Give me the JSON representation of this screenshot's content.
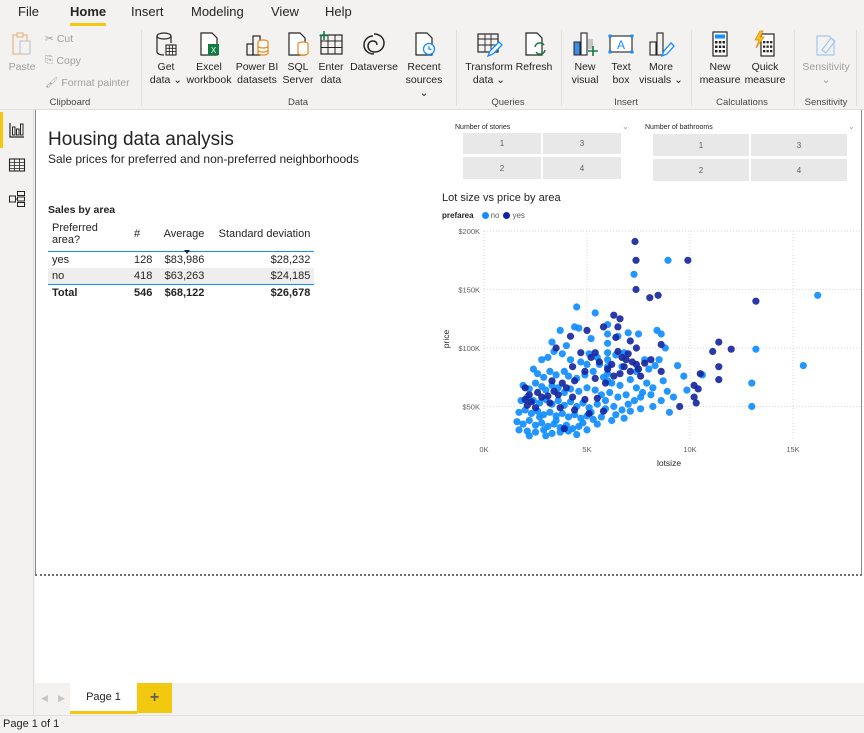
{
  "menu": {
    "items": [
      "File",
      "Home",
      "Insert",
      "Modeling",
      "View",
      "Help"
    ],
    "active": "Home"
  },
  "ribbon": {
    "clipboard": {
      "paste": "Paste",
      "cut": "Cut",
      "copy": "Copy",
      "format_painter": "Format painter",
      "group": "Clipboard"
    },
    "data": {
      "get_data": [
        "Get",
        "data"
      ],
      "excel": [
        "Excel",
        "workbook"
      ],
      "pbi_datasets": [
        "Power BI",
        "datasets"
      ],
      "sql": [
        "SQL",
        "Server"
      ],
      "enter_data": [
        "Enter",
        "data"
      ],
      "dataverse": [
        "Dataverse",
        ""
      ],
      "recent": [
        "Recent",
        "sources"
      ],
      "group": "Data"
    },
    "queries": {
      "transform": [
        "Transform",
        "data"
      ],
      "refresh": [
        "Refresh",
        ""
      ],
      "group": "Queries"
    },
    "insert": {
      "new_visual": [
        "New",
        "visual"
      ],
      "text_box": [
        "Text",
        "box"
      ],
      "more_visuals": [
        "More",
        "visuals"
      ],
      "group": "Insert"
    },
    "calculations": {
      "new_measure": [
        "New",
        "measure"
      ],
      "quick_measure": [
        "Quick",
        "measure"
      ],
      "group": "Calculations"
    },
    "sensitivity": {
      "label": "Sensitivity",
      "group": "Sensitivity"
    }
  },
  "report": {
    "title": "Housing data analysis",
    "subtitle": "Sale prices for preferred and non-preferred neighborhoods",
    "table": {
      "title": "Sales by area",
      "headers": [
        "Preferred area?",
        "#",
        "Average",
        "Standard deviation"
      ],
      "sorted_column": "Average",
      "rows": [
        [
          "yes",
          "128",
          "$83,986",
          "$28,232"
        ],
        [
          "no",
          "418",
          "$63,263",
          "$24,185"
        ]
      ],
      "total": [
        "Total",
        "546",
        "$68,122",
        "$26,678"
      ]
    },
    "slicers": [
      {
        "title": "Number of stories",
        "options": [
          "1",
          "3",
          "2",
          "4"
        ]
      },
      {
        "title": "Number of bathrooms",
        "options": [
          "1",
          "3",
          "2",
          "4"
        ]
      }
    ]
  },
  "chart_data": {
    "type": "scatter",
    "title": "Lot size vs price by area",
    "xlabel": "lotsize",
    "ylabel": "price",
    "legend_title": "prefarea",
    "legend_placement": "top-left",
    "grid": true,
    "xlim": [
      0,
      17000
    ],
    "ylim": [
      22000,
      205000
    ],
    "xticks": [
      {
        "v": 0,
        "label": "0K"
      },
      {
        "v": 5000,
        "label": "5K"
      },
      {
        "v": 10000,
        "label": "10K"
      },
      {
        "v": 15000,
        "label": "15K"
      }
    ],
    "yticks": [
      {
        "v": 50000,
        "label": "$50K"
      },
      {
        "v": 100000,
        "label": "$100K"
      },
      {
        "v": 150000,
        "label": "$150K"
      },
      {
        "v": 200000,
        "label": "$200K"
      }
    ],
    "series": [
      {
        "name": "no",
        "color": "#118dff",
        "points": [
          [
            7280,
            163000
          ],
          [
            8930,
            175000
          ],
          [
            16200,
            145000
          ],
          [
            13200,
            99000
          ],
          [
            15500,
            85000
          ],
          [
            13000,
            70000
          ],
          [
            13000,
            50000
          ],
          [
            10600,
            77000
          ],
          [
            9700,
            76000
          ],
          [
            9850,
            64000
          ],
          [
            9000,
            45000
          ],
          [
            9400,
            85000
          ],
          [
            4500,
            135000
          ],
          [
            5400,
            130000
          ],
          [
            6000,
            120000
          ],
          [
            6000,
            112000
          ],
          [
            6000,
            104000
          ],
          [
            6000,
            96000
          ],
          [
            6000,
            90000
          ],
          [
            6000,
            84000
          ],
          [
            6000,
            78000
          ],
          [
            6000,
            72000
          ],
          [
            3700,
            115000
          ],
          [
            4400,
            118000
          ],
          [
            4600,
            117000
          ],
          [
            5200,
            108000
          ],
          [
            6500,
            110000
          ],
          [
            7000,
            113000
          ],
          [
            7500,
            112000
          ],
          [
            8400,
            115000
          ],
          [
            8600,
            112000
          ],
          [
            8800,
            100000
          ],
          [
            8500,
            90000
          ],
          [
            8300,
            85000
          ],
          [
            2800,
            90000
          ],
          [
            3100,
            92000
          ],
          [
            3400,
            97000
          ],
          [
            3800,
            95000
          ],
          [
            4200,
            90000
          ],
          [
            4700,
            88000
          ],
          [
            5000,
            86000
          ],
          [
            5500,
            92000
          ],
          [
            6400,
            94000
          ],
          [
            6800,
            96000
          ],
          [
            7800,
            90000
          ],
          [
            8000,
            82000
          ],
          [
            2400,
            82000
          ],
          [
            2600,
            78000
          ],
          [
            2900,
            75000
          ],
          [
            3200,
            80000
          ],
          [
            3500,
            77000
          ],
          [
            3900,
            80000
          ],
          [
            4100,
            76000
          ],
          [
            4500,
            74000
          ],
          [
            4900,
            77000
          ],
          [
            5300,
            80000
          ],
          [
            5800,
            75000
          ],
          [
            6200,
            70000
          ],
          [
            6600,
            68000
          ],
          [
            7100,
            73000
          ],
          [
            7400,
            66000
          ],
          [
            7900,
            70000
          ],
          [
            1900,
            68000
          ],
          [
            2200,
            65000
          ],
          [
            2500,
            70000
          ],
          [
            2800,
            67000
          ],
          [
            3000,
            64000
          ],
          [
            3300,
            68000
          ],
          [
            3600,
            66000
          ],
          [
            3900,
            62000
          ],
          [
            4200,
            65000
          ],
          [
            4600,
            63000
          ],
          [
            5000,
            66000
          ],
          [
            5400,
            64000
          ],
          [
            5700,
            60000
          ],
          [
            6100,
            62000
          ],
          [
            6500,
            58000
          ],
          [
            6900,
            60000
          ],
          [
            7300,
            55000
          ],
          [
            7600,
            58000
          ],
          [
            8100,
            60000
          ],
          [
            1800,
            55000
          ],
          [
            2100,
            58000
          ],
          [
            2400,
            55000
          ],
          [
            2700,
            53000
          ],
          [
            3000,
            56000
          ],
          [
            3300,
            52000
          ],
          [
            3600,
            55000
          ],
          [
            3900,
            51000
          ],
          [
            4200,
            54000
          ],
          [
            4500,
            50000
          ],
          [
            4800,
            53000
          ],
          [
            5100,
            49000
          ],
          [
            5500,
            52000
          ],
          [
            5900,
            48000
          ],
          [
            6300,
            50000
          ],
          [
            6700,
            47000
          ],
          [
            7100,
            46000
          ],
          [
            7600,
            48000
          ],
          [
            1700,
            45000
          ],
          [
            2000,
            47000
          ],
          [
            2300,
            44000
          ],
          [
            2600,
            46000
          ],
          [
            2900,
            43000
          ],
          [
            3200,
            45000
          ],
          [
            3500,
            42000
          ],
          [
            3800,
            44000
          ],
          [
            4100,
            41000
          ],
          [
            4400,
            43000
          ],
          [
            4700,
            40000
          ],
          [
            5000,
            42000
          ],
          [
            5300,
            39000
          ],
          [
            5700,
            41000
          ],
          [
            6200,
            38000
          ],
          [
            6800,
            40000
          ],
          [
            1600,
            37000
          ],
          [
            1900,
            35000
          ],
          [
            2200,
            38000
          ],
          [
            2500,
            34000
          ],
          [
            2800,
            36000
          ],
          [
            3100,
            33000
          ],
          [
            3400,
            35000
          ],
          [
            3700,
            32000
          ],
          [
            4000,
            34000
          ],
          [
            4300,
            31000
          ],
          [
            4600,
            33000
          ],
          [
            5000,
            30000
          ],
          [
            5500,
            35000
          ],
          [
            1700,
            30000
          ],
          [
            2100,
            29000
          ],
          [
            2500,
            28000
          ],
          [
            2900,
            30000
          ],
          [
            3300,
            27000
          ],
          [
            3700,
            28000
          ],
          [
            4100,
            29000
          ],
          [
            4500,
            26000
          ],
          [
            3000,
            25000
          ],
          [
            2200,
            25000
          ],
          [
            3900,
            31000
          ],
          [
            3500,
            38000
          ],
          [
            2700,
            41000
          ],
          [
            4800,
            36000
          ],
          [
            5200,
            45000
          ],
          [
            5900,
            55000
          ],
          [
            6400,
            43000
          ],
          [
            7000,
            52000
          ],
          [
            7700,
            62000
          ],
          [
            8200,
            66000
          ],
          [
            8700,
            72000
          ],
          [
            8900,
            63000
          ],
          [
            8600,
            55000
          ],
          [
            8200,
            50000
          ],
          [
            9200,
            58000
          ],
          [
            7400,
            80000
          ],
          [
            6700,
            84000
          ],
          [
            5600,
            86000
          ],
          [
            5100,
            95000
          ],
          [
            4000,
            102000
          ],
          [
            3300,
            105000
          ]
        ]
      },
      {
        "name": "yes",
        "color": "#12239e",
        "points": [
          [
            7330,
            191000
          ],
          [
            7380,
            175000
          ],
          [
            7380,
            150000
          ],
          [
            9900,
            175000
          ],
          [
            13200,
            140000
          ],
          [
            8450,
            145000
          ],
          [
            8050,
            143000
          ],
          [
            11100,
            97000
          ],
          [
            11400,
            105000
          ],
          [
            12000,
            99000
          ],
          [
            10500,
            78000
          ],
          [
            11400,
            84000
          ],
          [
            10400,
            65000
          ],
          [
            11400,
            73000
          ],
          [
            10200,
            68000
          ],
          [
            10200,
            58000
          ],
          [
            10300,
            53000
          ],
          [
            9500,
            50000
          ],
          [
            8600,
            103000
          ],
          [
            6300,
            128000
          ],
          [
            6600,
            125000
          ],
          [
            6500,
            118000
          ],
          [
            5800,
            118000
          ],
          [
            5000,
            115000
          ],
          [
            4200,
            110000
          ],
          [
            6400,
            109000
          ],
          [
            7100,
            106000
          ],
          [
            7400,
            100000
          ],
          [
            6500,
            97000
          ],
          [
            6700,
            92000
          ],
          [
            6900,
            90000
          ],
          [
            7000,
            95000
          ],
          [
            7200,
            88000
          ],
          [
            7400,
            86000
          ],
          [
            6800,
            84000
          ],
          [
            7100,
            80000
          ],
          [
            6600,
            78000
          ],
          [
            7500,
            82000
          ],
          [
            7800,
            87000
          ],
          [
            8100,
            90000
          ],
          [
            6200,
            86000
          ],
          [
            6000,
            82000
          ],
          [
            5600,
            88000
          ],
          [
            5400,
            96000
          ],
          [
            7600,
            76000
          ],
          [
            8600,
            80000
          ],
          [
            3500,
            100000
          ],
          [
            4700,
            96000
          ],
          [
            5200,
            92000
          ],
          [
            4300,
            84000
          ],
          [
            4900,
            80000
          ],
          [
            5900,
            70000
          ],
          [
            5400,
            74000
          ],
          [
            6300,
            76000
          ],
          [
            4400,
            72000
          ],
          [
            3800,
            70000
          ],
          [
            2000,
            66000
          ],
          [
            2200,
            60000
          ],
          [
            2000,
            56000
          ],
          [
            2300,
            54000
          ],
          [
            2100,
            51000
          ],
          [
            2600,
            62000
          ],
          [
            2800,
            58000
          ],
          [
            3400,
            63000
          ],
          [
            3100,
            59000
          ],
          [
            3600,
            60000
          ],
          [
            4300,
            58000
          ],
          [
            4900,
            56000
          ],
          [
            5500,
            57000
          ],
          [
            3200,
            53000
          ],
          [
            2500,
            49000
          ],
          [
            3700,
            49000
          ],
          [
            4400,
            47000
          ],
          [
            5100,
            44000
          ],
          [
            5800,
            46000
          ],
          [
            4000,
            66000
          ],
          [
            3300,
            72000
          ],
          [
            3900,
            31000
          ]
        ]
      }
    ]
  },
  "pages": {
    "tabs": [
      "Page 1"
    ],
    "add_label": "+",
    "status": "Page 1 of 1"
  }
}
